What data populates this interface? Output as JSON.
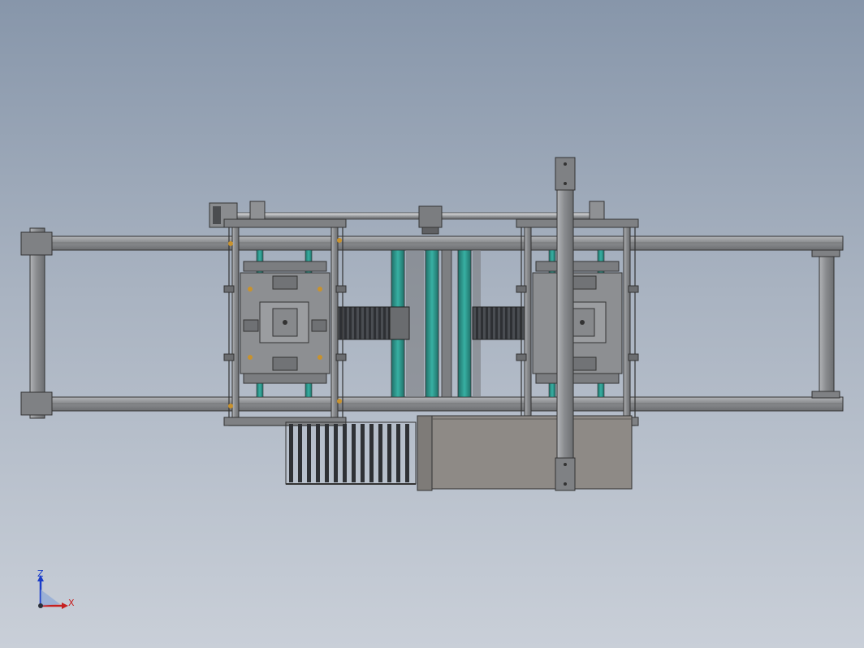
{
  "colors": {
    "background_top": "#8796aa",
    "background_bottom": "#c9cfd8",
    "frame_steel": "#8a8c8f",
    "frame_edge": "#3a3b3d",
    "dark_plate": "#5f6063",
    "teal_profile": "#2f9a8f",
    "chain": "#3c3e42",
    "box_cover": "#8e8a86",
    "triad_z": "#1a3cc9",
    "triad_x": "#c62020"
  },
  "triad": {
    "z_label": "Z",
    "x_label": "X"
  }
}
